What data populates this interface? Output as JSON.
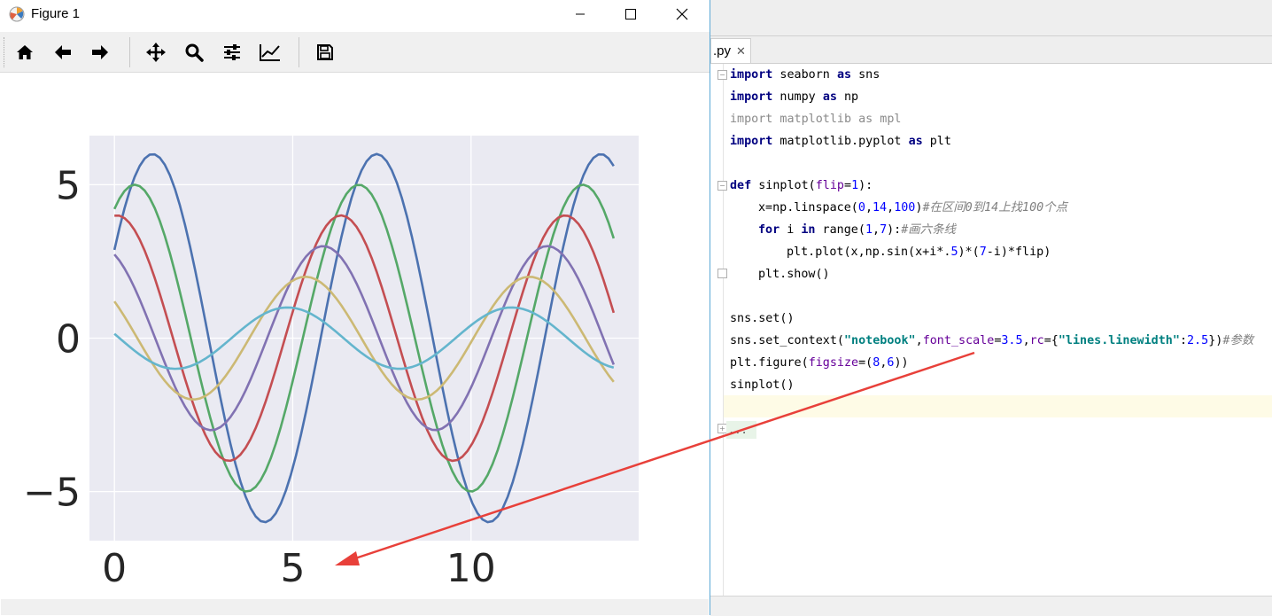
{
  "window": {
    "title": "Figure 1",
    "minimize_glyph": "—",
    "maximize_glyph": "☐",
    "close_glyph": "✕"
  },
  "toolbar": {
    "buttons": [
      {
        "name": "home",
        "icon": "home-icon"
      },
      {
        "name": "back",
        "icon": "arrow-left-icon"
      },
      {
        "name": "forward",
        "icon": "arrow-right-icon"
      },
      {
        "name": "pan",
        "icon": "move-icon"
      },
      {
        "name": "zoom",
        "icon": "magnifier-icon"
      },
      {
        "name": "configure-subplots",
        "icon": "sliders-icon"
      },
      {
        "name": "edit-axis",
        "icon": "line-chart-icon"
      },
      {
        "name": "save",
        "icon": "floppy-disk-icon"
      }
    ]
  },
  "chart_data": {
    "type": "line",
    "title": "",
    "xlabel": "",
    "ylabel": "",
    "xlim": [
      -0.7,
      14.7
    ],
    "ylim": [
      -6.6,
      6.6
    ],
    "xticks": [
      0,
      5,
      10
    ],
    "yticks": [
      5,
      0,
      -5
    ],
    "xtick_labels": [
      "0",
      "5",
      "10"
    ],
    "ytick_labels": [
      "5",
      "0",
      "−5"
    ],
    "grid": true,
    "background": "#eaeaf2",
    "function": "y = sin(x + i*0.5) * (7 - i), x in linspace(0, 14, 100), i = 1..6",
    "series": [
      {
        "color": "#4c72b0",
        "amplitude": 6,
        "phase": 0.5
      },
      {
        "color": "#55a868",
        "amplitude": 5,
        "phase": 1.0
      },
      {
        "color": "#c44e52",
        "amplitude": 4,
        "phase": 1.5
      },
      {
        "color": "#8172b2",
        "amplitude": 3,
        "phase": 2.0
      },
      {
        "color": "#ccb974",
        "amplitude": 2,
        "phase": 2.5
      },
      {
        "color": "#64b5cd",
        "amplitude": 1,
        "phase": 3.0
      }
    ],
    "x_start": 0,
    "x_end": 14
  },
  "editor": {
    "tab_label": ".py",
    "tab_close": "✕",
    "folded_marker": "...",
    "annotation_color": "#e8403a"
  },
  "code": {
    "l1_kw": "import",
    "l1_rest": " seaborn ",
    "l1_as": "as",
    "l1_end": " sns",
    "l2_kw": "import",
    "l2_rest": " numpy ",
    "l2_as": "as",
    "l2_end": " np",
    "l3": "import matplotlib as mpl",
    "l4_kw": "import",
    "l4_rest": " matplotlib.pyplot ",
    "l4_as": "as",
    "l4_end": " plt",
    "l5_kw": "def",
    "l5_name": " sinplot(",
    "l5_param": "flip",
    "l5_eq": "=",
    "l5_num": "1",
    "l5_end": "):",
    "l6_a": "x=np.linspace(",
    "l6_n1": "0",
    "l6_c1": ",",
    "l6_n2": "14",
    "l6_c2": ",",
    "l6_n3": "100",
    "l6_b": ")",
    "l6_cmt": "#在区间0到14上找100个点",
    "l7_for": "for",
    "l7_i": " i ",
    "l7_in": "in",
    "l7_range": " range(",
    "l7_n1": "1",
    "l7_c": ",",
    "l7_n2": "7",
    "l7_b": "):",
    "l7_cmt": "#画六条线",
    "l8_a": "plt.plot(x,np.sin(x+i*.",
    "l8_n": "5",
    "l8_b": ")*(",
    "l8_n2": "7",
    "l8_c": "-i)*flip)",
    "l9": "plt.show()",
    "l10": "sns.set()",
    "l11_a": "sns.set_context(",
    "l11_s1": "\"notebook\"",
    "l11_b": ",",
    "l11_p1": "font_scale",
    "l11_eq": "=",
    "l11_n1": "3.5",
    "l11_c": ",",
    "l11_p2": "rc",
    "l11_d": "={",
    "l11_s2": "\"lines.linewidth\"",
    "l11_e": ":",
    "l11_n2": "2.5",
    "l11_f": "})",
    "l11_cmt": "#参数",
    "l12_a": "plt.figure(",
    "l12_p": "figsize",
    "l12_eq": "=(",
    "l12_n1": "8",
    "l12_c": ",",
    "l12_n2": "6",
    "l12_b": "))",
    "l13": "sinplot()"
  }
}
